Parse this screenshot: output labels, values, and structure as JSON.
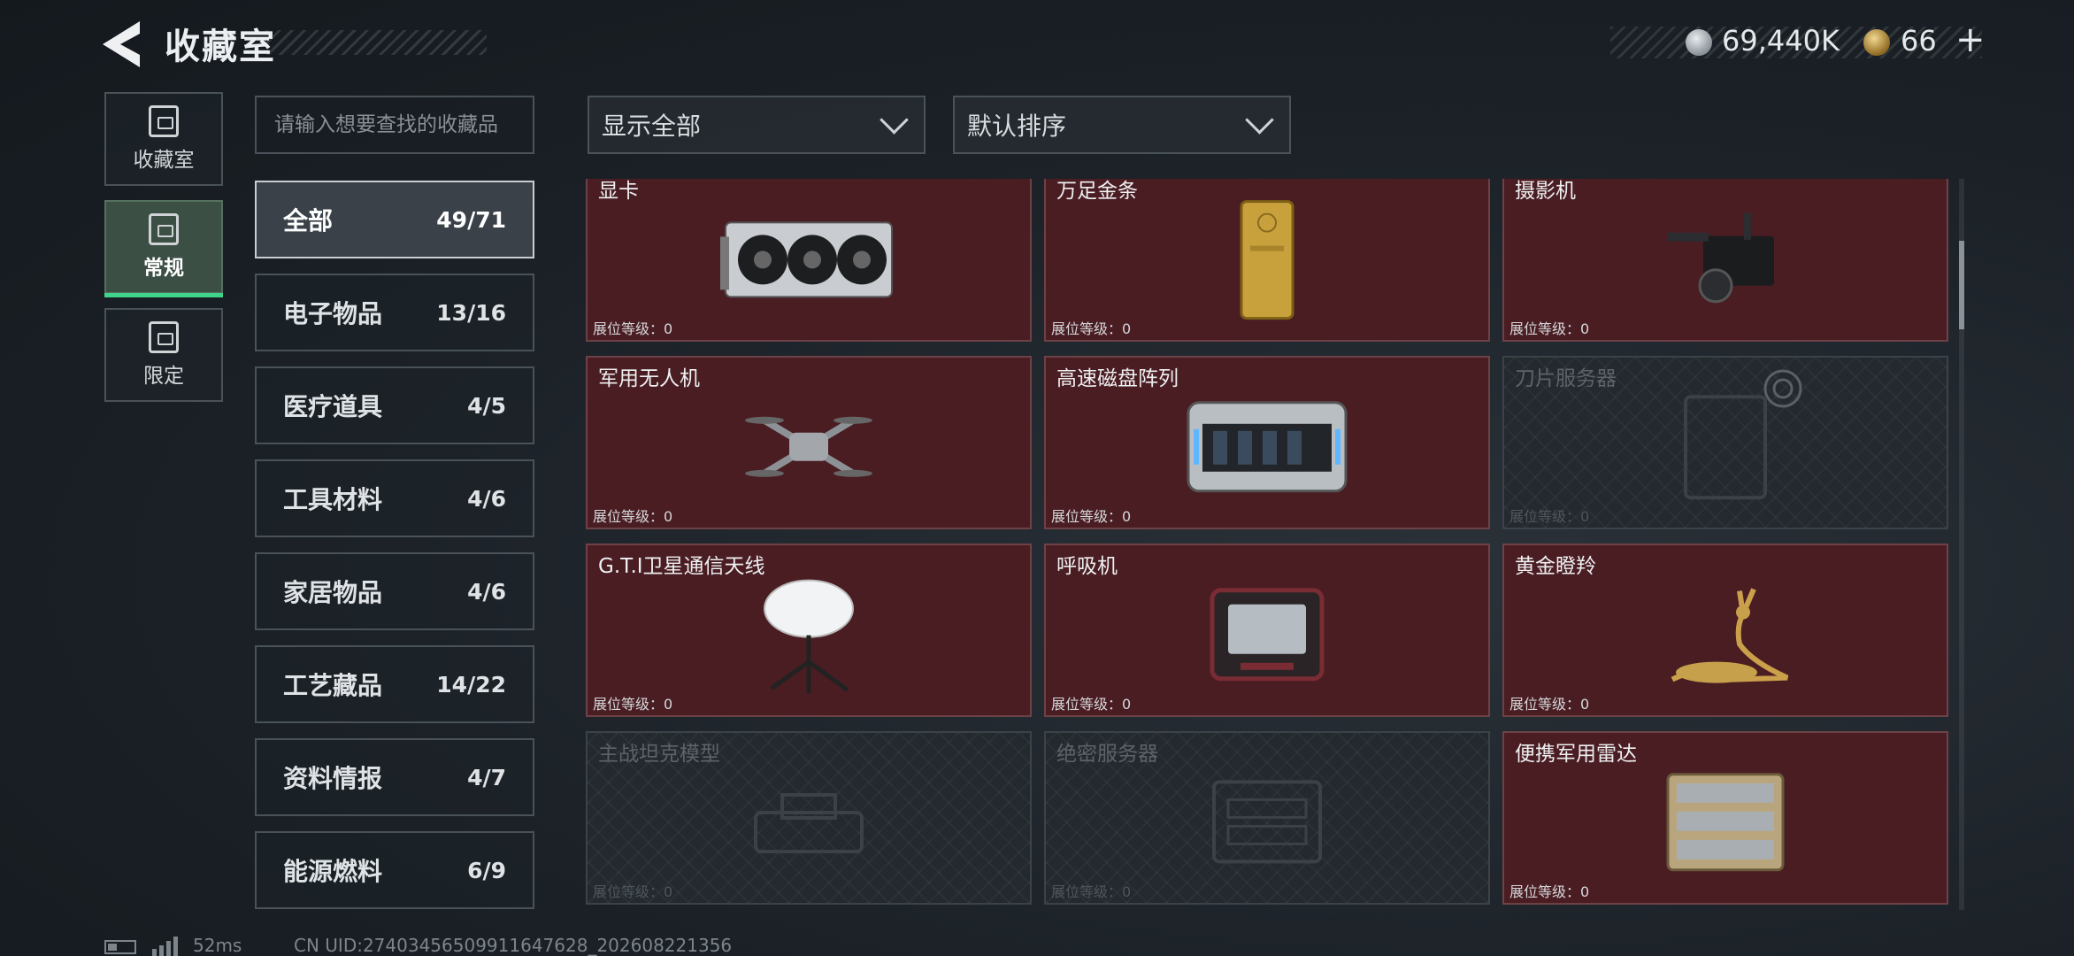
{
  "header": {
    "title": "收藏室",
    "silver_amount": "69,440K",
    "gold_amount": "66",
    "plus_label": "+"
  },
  "rail": [
    {
      "label": "收藏室",
      "icon": "vault-icon",
      "active": false
    },
    {
      "label": "常规",
      "icon": "document-icon",
      "active": true
    },
    {
      "label": "限定",
      "icon": "picture-icon",
      "active": false
    }
  ],
  "search": {
    "placeholder": "请输入想要查找的收藏品"
  },
  "categories": [
    {
      "name": "全部",
      "count": "49/71",
      "active": true
    },
    {
      "name": "电子物品",
      "count": "13/16"
    },
    {
      "name": "医疗道具",
      "count": "4/5"
    },
    {
      "name": "工具材料",
      "count": "4/6"
    },
    {
      "name": "家居物品",
      "count": "4/6"
    },
    {
      "name": "工艺藏品",
      "count": "14/22"
    },
    {
      "name": "资料情报",
      "count": "4/7"
    },
    {
      "name": "能源燃料",
      "count": "6/9"
    }
  ],
  "filters": {
    "show_label": "显示全部",
    "sort_label": "默认排序"
  },
  "items": [
    {
      "name": "显卡",
      "level": "展位等级：0",
      "owned": true,
      "icon": "gpu-icon"
    },
    {
      "name": "万足金条",
      "level": "展位等级：0",
      "owned": true,
      "icon": "gold-bar-icon"
    },
    {
      "name": "摄影机",
      "level": "展位等级：0",
      "owned": true,
      "icon": "camera-icon"
    },
    {
      "name": "军用无人机",
      "level": "展位等级：0",
      "owned": true,
      "icon": "drone-icon"
    },
    {
      "name": "高速磁盘阵列",
      "level": "展位等级：0",
      "owned": true,
      "icon": "disk-array-icon"
    },
    {
      "name": "刀片服务器",
      "level": "展位等级：0",
      "owned": false,
      "icon": "blade-server-icon"
    },
    {
      "name": "G.T.I卫星通信天线",
      "level": "展位等级：0",
      "owned": true,
      "icon": "satellite-dish-icon"
    },
    {
      "name": "呼吸机",
      "level": "展位等级：0",
      "owned": true,
      "icon": "ventilator-icon"
    },
    {
      "name": "黄金瞪羚",
      "level": "展位等级：0",
      "owned": true,
      "icon": "golden-gazelle-icon"
    },
    {
      "name": "主战坦克模型",
      "level": "展位等级：0",
      "owned": false,
      "icon": "tank-model-icon"
    },
    {
      "name": "绝密服务器",
      "level": "展位等级：0",
      "owned": false,
      "icon": "server-icon"
    },
    {
      "name": "便携军用雷达",
      "level": "展位等级：0",
      "owned": true,
      "icon": "radar-icon"
    }
  ],
  "footer": {
    "ping": "52ms",
    "uid": "CN UID:27403456509911647628_202608221356"
  }
}
